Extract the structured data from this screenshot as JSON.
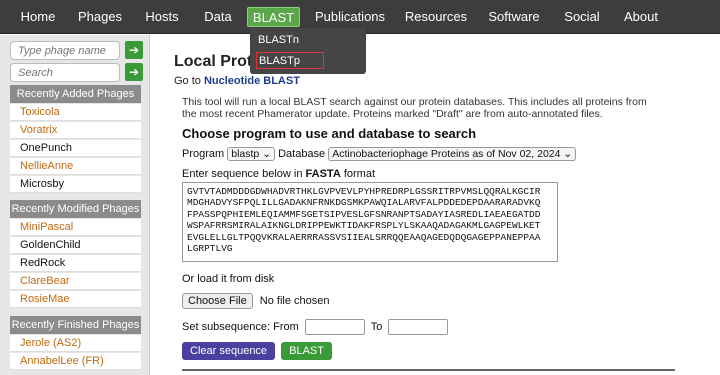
{
  "nav": {
    "items": [
      {
        "label": "Home"
      },
      {
        "label": "Phages"
      },
      {
        "label": "Hosts"
      },
      {
        "label": "Data"
      },
      {
        "label": "BLAST"
      },
      {
        "label": "Publications"
      },
      {
        "label": "Resources"
      },
      {
        "label": "Software"
      },
      {
        "label": "Social"
      },
      {
        "label": "About"
      }
    ],
    "active": "BLAST",
    "dropdown": [
      "BLASTn",
      "BLASTp"
    ]
  },
  "sidebar": {
    "phage_placeholder": "Type phage name",
    "search_placeholder": "Search",
    "go_glyph": "➔",
    "recently_added": {
      "title": "Recently Added Phages",
      "items": [
        "Toxicola",
        "Voratrix",
        "OnePunch",
        "NellieAnne",
        "Microsby"
      ]
    },
    "recently_modified": {
      "title": "Recently Modified Phages",
      "items": [
        "MiniPascal",
        "GoldenChild",
        "RedRock",
        "ClareBear",
        "RosieMae"
      ]
    },
    "recently_finished": {
      "title": "Recently Finished Phages",
      "items": [
        "Jerole (AS2)",
        "AnnabelLee (FR)"
      ]
    }
  },
  "main": {
    "title": "Local Prot",
    "goto_prefix": "Go to",
    "goto_link": "Nucleotide BLAST",
    "description": "This tool will run a local BLAST search against our protein databases. This includes all proteins from the most recent Phamerator update. Proteins marked \"Draft\" are from auto-annotated files.",
    "section_title": "Choose program to use and database to search",
    "program_label": "Program",
    "program_value": "blastp",
    "database_label": "Database",
    "database_value": "Actinobacteriophage Proteins as of Nov 02, 2024",
    "fasta_label_pre": "Enter sequence below in",
    "fasta_label_bold": "FASTA",
    "fasta_label_post": "format",
    "sequence": "GVTVTADMDDDGDWHADVRTHKLGVPVEVLPYHPREDRPLGSSRITRPVMSLQQRALKGCIR\nMDGHADVYSFPQLILLGADAKNFRNKDGSMKPAWQIALARVFALPDDEDEPDAARARADVKQ\nFPASSPQPHIEMLEQIAMMFSGETSIPVESLGFSNRANPTSADAYIASREDLIAEAEGATDD\nWSPAFRRSMIRALAIKNGLDRIPPEWKTIDAKFRSPLYLSKAAQADAGAKMLGAGPEWLKET\nEVGLELLGLTPQQVKRALAERRRASSVSIIEALSRRQQEAAQAGEDQDQGAGEPPANEPPAA\nLGRPTLVG",
    "load_label": "Or load it from disk",
    "choose_file_label": "Choose File",
    "no_file_label": "No file chosen",
    "subseq_label": "Set subsequence: From",
    "to_label": "To",
    "clear_button": "Clear sequence",
    "blast_button": "BLAST"
  },
  "colors": {
    "navbar": "#3d3d3d",
    "active_tab": "#5aa84a",
    "go_button": "#3a9a37",
    "section_header": "#8b8b8b",
    "phage_orange": "#c06a10",
    "clear_button": "#4b3fa0",
    "link": "#1d3f8a"
  }
}
